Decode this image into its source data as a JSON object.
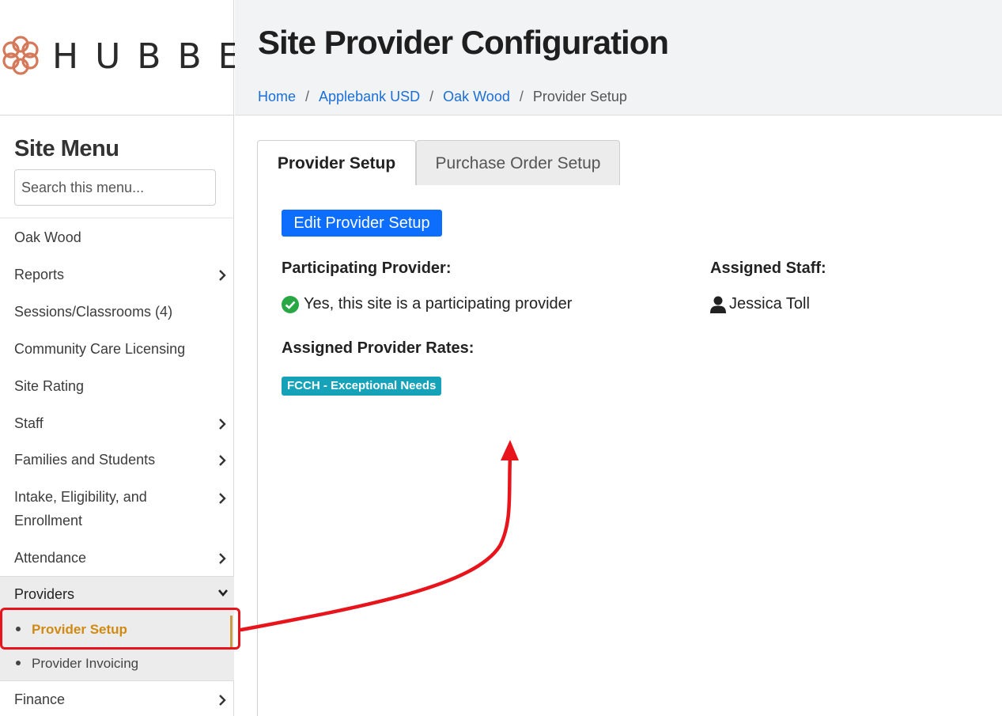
{
  "brand": {
    "logo_text": "HUBBE",
    "logo_color": "#d4795a"
  },
  "sidebar": {
    "title": "Site Menu",
    "search_placeholder": "Search this menu...",
    "items": [
      {
        "label": "Oak Wood",
        "has_chevron": false
      },
      {
        "label": "Reports",
        "has_chevron": true
      },
      {
        "label": "Sessions/Classrooms (4)",
        "has_chevron": false
      },
      {
        "label": "Community Care Licensing",
        "has_chevron": false
      },
      {
        "label": "Site Rating",
        "has_chevron": false
      },
      {
        "label": "Staff",
        "has_chevron": true
      },
      {
        "label": "Families and Students",
        "has_chevron": true
      },
      {
        "label": "Intake, Eligibility, and Enrollment",
        "has_chevron": true
      },
      {
        "label": "Attendance",
        "has_chevron": true
      }
    ],
    "providers": {
      "label": "Providers",
      "expanded": true,
      "sub_items": [
        {
          "label": "Provider Setup",
          "active": true
        },
        {
          "label": "Provider Invoicing",
          "active": false
        }
      ]
    },
    "finance": {
      "label": "Finance",
      "has_chevron": true
    }
  },
  "header": {
    "title": "Site Provider Configuration",
    "breadcrumb": [
      {
        "label": "Home",
        "link": true
      },
      {
        "label": "Applebank USD",
        "link": true
      },
      {
        "label": "Oak Wood",
        "link": true
      },
      {
        "label": "Provider Setup",
        "link": false
      }
    ]
  },
  "tabs": [
    {
      "label": "Provider Setup",
      "active": true
    },
    {
      "label": "Purchase Order Setup",
      "active": false
    }
  ],
  "provider_setup": {
    "edit_button": "Edit Provider Setup",
    "participating_label": "Participating Provider:",
    "participating_value": "Yes, this site is a participating provider",
    "assigned_staff_label": "Assigned Staff:",
    "assigned_staff_value": "Jessica Toll",
    "rates_label": "Assigned Provider Rates:",
    "rates": [
      "FCCH - Exceptional Needs"
    ]
  },
  "colors": {
    "link": "#1a6fd6",
    "primary_button": "#0d6efd",
    "badge": "#16a2b8",
    "active_menu": "#d08a12",
    "check": "#28a745",
    "annotation": "#e8141c"
  },
  "icons": [
    "flower-logo-icon",
    "chevron-right-icon",
    "chevron-down-icon",
    "check-circle-icon",
    "user-icon"
  ]
}
